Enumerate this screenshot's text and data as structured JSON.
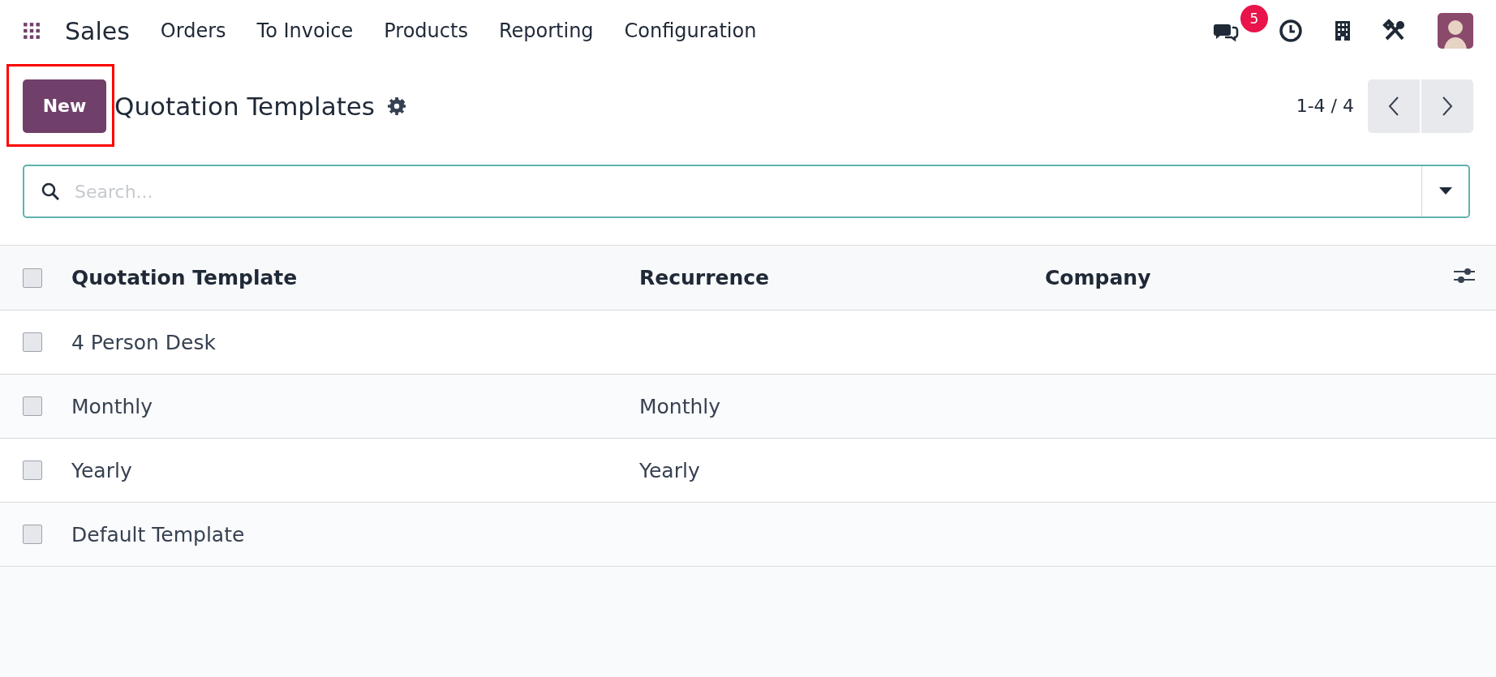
{
  "navbar": {
    "app_name": "Sales",
    "menu": [
      "Orders",
      "To Invoice",
      "Products",
      "Reporting",
      "Configuration"
    ],
    "message_count": "5"
  },
  "control_panel": {
    "new_button": "New",
    "title": "Quotation Templates",
    "pager": "1-4 / 4"
  },
  "search": {
    "placeholder": "Search..."
  },
  "table": {
    "columns": [
      "Quotation Template",
      "Recurrence",
      "Company"
    ],
    "header_checked": false,
    "rows": [
      {
        "name": "4 Person Desk",
        "recurrence": "",
        "company": "",
        "checked": false
      },
      {
        "name": "Monthly",
        "recurrence": "Monthly",
        "company": "",
        "checked": false
      },
      {
        "name": "Yearly",
        "recurrence": "Yearly",
        "company": "",
        "checked": false
      },
      {
        "name": "Default Template",
        "recurrence": "",
        "company": "",
        "checked": false
      }
    ]
  }
}
